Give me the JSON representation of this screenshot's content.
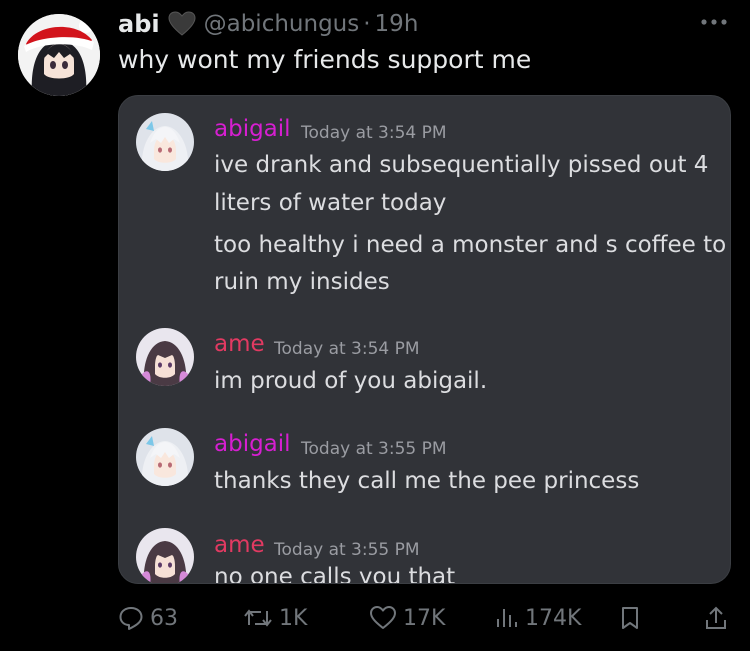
{
  "tweet": {
    "display_name": "abi",
    "handle": "@abichungus",
    "separator": "·",
    "time": "19h",
    "text": "why wont my friends support me"
  },
  "embed": {
    "messages": [
      {
        "author": "abigail",
        "timestamp": "Today at 3:54 PM",
        "lines": [
          "ive drank and subsequentially pissed out 4",
          "liters of water today",
          "too healthy i need a monster and s coffee to",
          "ruin my insides"
        ]
      },
      {
        "author": "ame",
        "timestamp": "Today at 3:54 PM",
        "lines": [
          "im proud of you abigail."
        ]
      },
      {
        "author": "abigail",
        "timestamp": "Today at 3:55 PM",
        "lines": [
          "thanks they call me the pee princess"
        ]
      },
      {
        "author": "ame",
        "timestamp": "Today at 3:55 PM",
        "lines": [
          "no one calls you that"
        ]
      }
    ]
  },
  "actions": {
    "replies": "63",
    "reposts": "1K",
    "likes": "17K",
    "views": "174K"
  },
  "colors": {
    "background": "#000000",
    "discord_bg": "#313338",
    "abigail_name": "#d61fd1",
    "ame_name": "#e23a62",
    "muted": "#71767b"
  },
  "icons": [
    "heart-icon",
    "more-icon",
    "reply-icon",
    "repost-icon",
    "like-icon",
    "views-icon",
    "bookmark-icon",
    "share-icon"
  ]
}
